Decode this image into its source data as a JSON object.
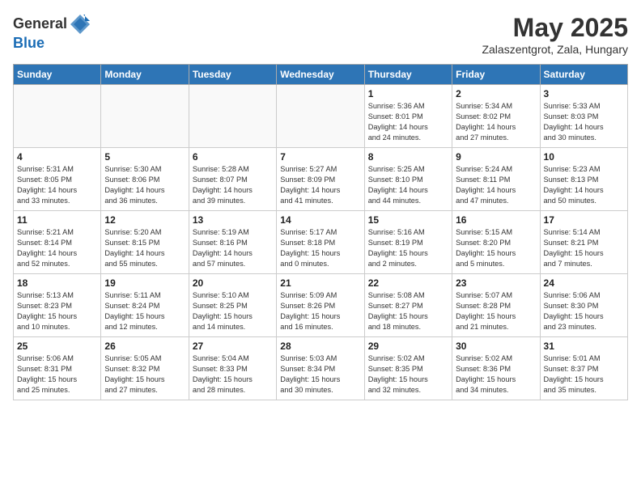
{
  "header": {
    "logo_general": "General",
    "logo_blue": "Blue",
    "month": "May 2025",
    "location": "Zalaszentgrot, Zala, Hungary"
  },
  "days_of_week": [
    "Sunday",
    "Monday",
    "Tuesday",
    "Wednesday",
    "Thursday",
    "Friday",
    "Saturday"
  ],
  "weeks": [
    [
      {
        "day": "",
        "info": ""
      },
      {
        "day": "",
        "info": ""
      },
      {
        "day": "",
        "info": ""
      },
      {
        "day": "",
        "info": ""
      },
      {
        "day": "1",
        "info": "Sunrise: 5:36 AM\nSunset: 8:01 PM\nDaylight: 14 hours\nand 24 minutes."
      },
      {
        "day": "2",
        "info": "Sunrise: 5:34 AM\nSunset: 8:02 PM\nDaylight: 14 hours\nand 27 minutes."
      },
      {
        "day": "3",
        "info": "Sunrise: 5:33 AM\nSunset: 8:03 PM\nDaylight: 14 hours\nand 30 minutes."
      }
    ],
    [
      {
        "day": "4",
        "info": "Sunrise: 5:31 AM\nSunset: 8:05 PM\nDaylight: 14 hours\nand 33 minutes."
      },
      {
        "day": "5",
        "info": "Sunrise: 5:30 AM\nSunset: 8:06 PM\nDaylight: 14 hours\nand 36 minutes."
      },
      {
        "day": "6",
        "info": "Sunrise: 5:28 AM\nSunset: 8:07 PM\nDaylight: 14 hours\nand 39 minutes."
      },
      {
        "day": "7",
        "info": "Sunrise: 5:27 AM\nSunset: 8:09 PM\nDaylight: 14 hours\nand 41 minutes."
      },
      {
        "day": "8",
        "info": "Sunrise: 5:25 AM\nSunset: 8:10 PM\nDaylight: 14 hours\nand 44 minutes."
      },
      {
        "day": "9",
        "info": "Sunrise: 5:24 AM\nSunset: 8:11 PM\nDaylight: 14 hours\nand 47 minutes."
      },
      {
        "day": "10",
        "info": "Sunrise: 5:23 AM\nSunset: 8:13 PM\nDaylight: 14 hours\nand 50 minutes."
      }
    ],
    [
      {
        "day": "11",
        "info": "Sunrise: 5:21 AM\nSunset: 8:14 PM\nDaylight: 14 hours\nand 52 minutes."
      },
      {
        "day": "12",
        "info": "Sunrise: 5:20 AM\nSunset: 8:15 PM\nDaylight: 14 hours\nand 55 minutes."
      },
      {
        "day": "13",
        "info": "Sunrise: 5:19 AM\nSunset: 8:16 PM\nDaylight: 14 hours\nand 57 minutes."
      },
      {
        "day": "14",
        "info": "Sunrise: 5:17 AM\nSunset: 8:18 PM\nDaylight: 15 hours\nand 0 minutes."
      },
      {
        "day": "15",
        "info": "Sunrise: 5:16 AM\nSunset: 8:19 PM\nDaylight: 15 hours\nand 2 minutes."
      },
      {
        "day": "16",
        "info": "Sunrise: 5:15 AM\nSunset: 8:20 PM\nDaylight: 15 hours\nand 5 minutes."
      },
      {
        "day": "17",
        "info": "Sunrise: 5:14 AM\nSunset: 8:21 PM\nDaylight: 15 hours\nand 7 minutes."
      }
    ],
    [
      {
        "day": "18",
        "info": "Sunrise: 5:13 AM\nSunset: 8:23 PM\nDaylight: 15 hours\nand 10 minutes."
      },
      {
        "day": "19",
        "info": "Sunrise: 5:11 AM\nSunset: 8:24 PM\nDaylight: 15 hours\nand 12 minutes."
      },
      {
        "day": "20",
        "info": "Sunrise: 5:10 AM\nSunset: 8:25 PM\nDaylight: 15 hours\nand 14 minutes."
      },
      {
        "day": "21",
        "info": "Sunrise: 5:09 AM\nSunset: 8:26 PM\nDaylight: 15 hours\nand 16 minutes."
      },
      {
        "day": "22",
        "info": "Sunrise: 5:08 AM\nSunset: 8:27 PM\nDaylight: 15 hours\nand 18 minutes."
      },
      {
        "day": "23",
        "info": "Sunrise: 5:07 AM\nSunset: 8:28 PM\nDaylight: 15 hours\nand 21 minutes."
      },
      {
        "day": "24",
        "info": "Sunrise: 5:06 AM\nSunset: 8:30 PM\nDaylight: 15 hours\nand 23 minutes."
      }
    ],
    [
      {
        "day": "25",
        "info": "Sunrise: 5:06 AM\nSunset: 8:31 PM\nDaylight: 15 hours\nand 25 minutes."
      },
      {
        "day": "26",
        "info": "Sunrise: 5:05 AM\nSunset: 8:32 PM\nDaylight: 15 hours\nand 27 minutes."
      },
      {
        "day": "27",
        "info": "Sunrise: 5:04 AM\nSunset: 8:33 PM\nDaylight: 15 hours\nand 28 minutes."
      },
      {
        "day": "28",
        "info": "Sunrise: 5:03 AM\nSunset: 8:34 PM\nDaylight: 15 hours\nand 30 minutes."
      },
      {
        "day": "29",
        "info": "Sunrise: 5:02 AM\nSunset: 8:35 PM\nDaylight: 15 hours\nand 32 minutes."
      },
      {
        "day": "30",
        "info": "Sunrise: 5:02 AM\nSunset: 8:36 PM\nDaylight: 15 hours\nand 34 minutes."
      },
      {
        "day": "31",
        "info": "Sunrise: 5:01 AM\nSunset: 8:37 PM\nDaylight: 15 hours\nand 35 minutes."
      }
    ]
  ]
}
